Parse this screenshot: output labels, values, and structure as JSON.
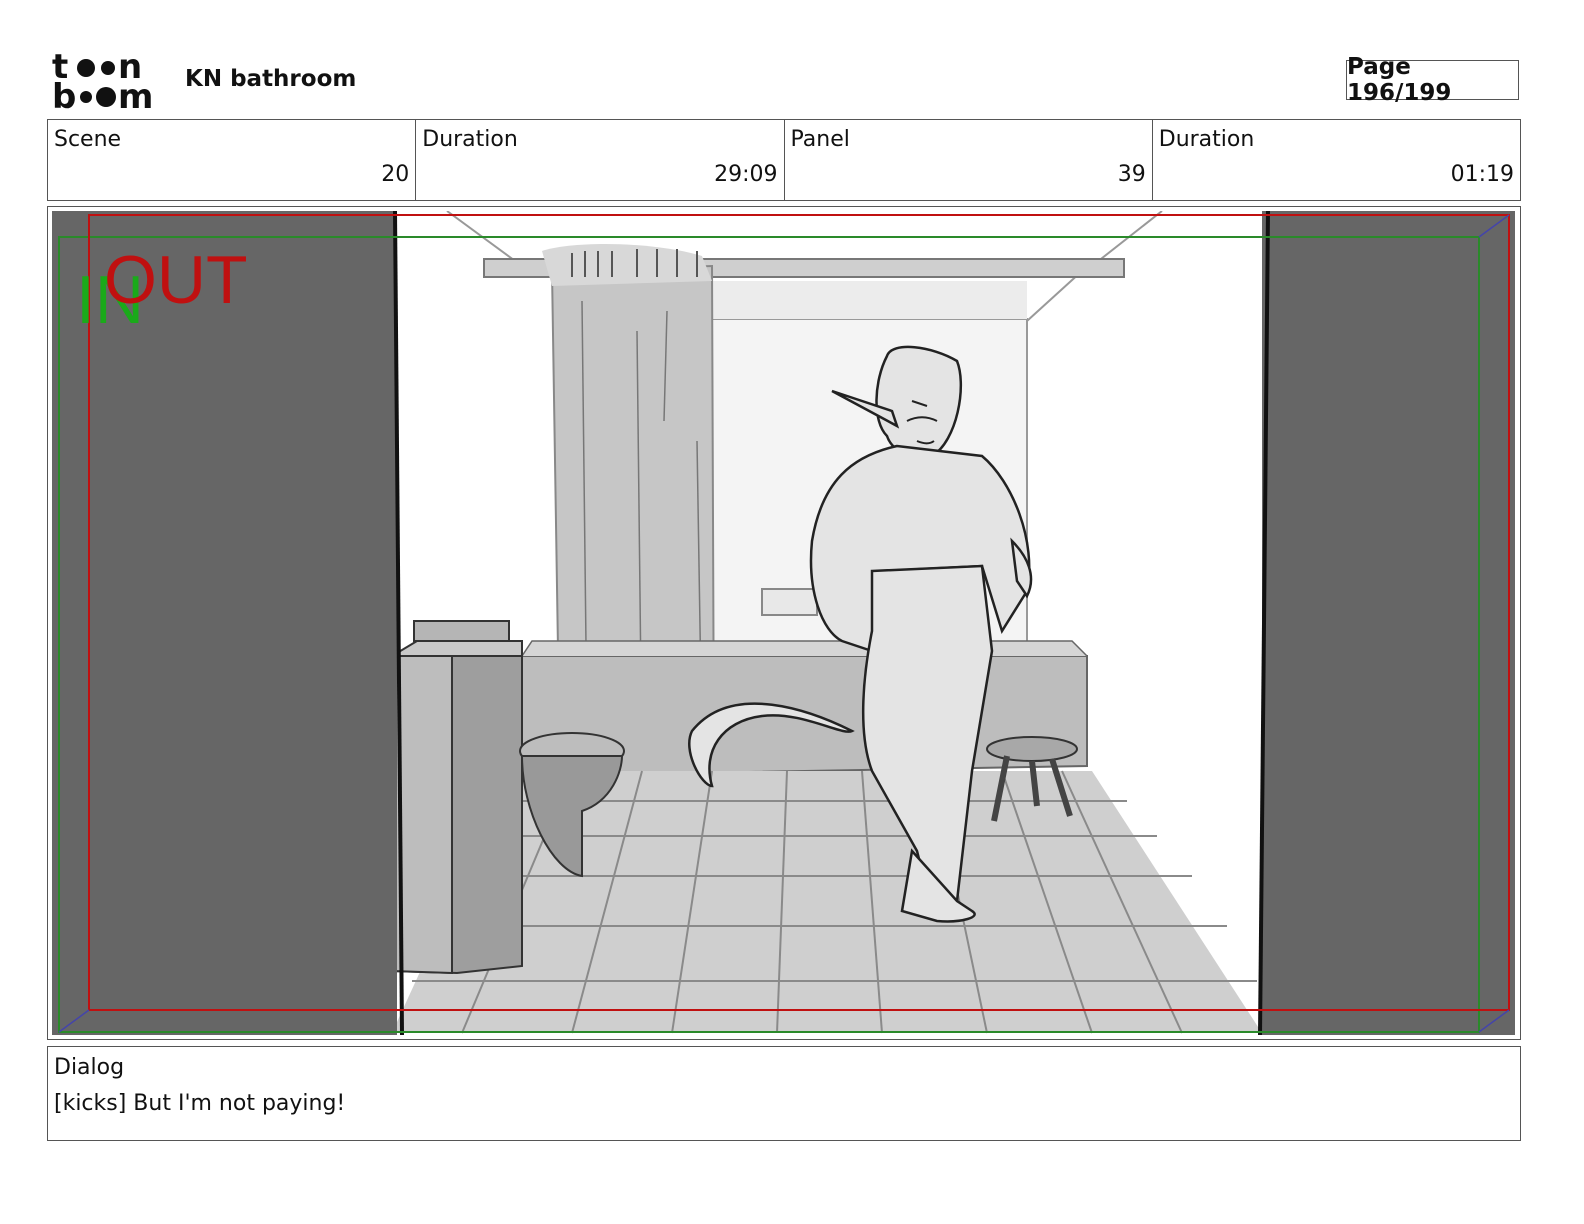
{
  "header": {
    "logo_text": "toon boom",
    "project_title": "KN bathroom",
    "page_label": "Page 196/199"
  },
  "info": {
    "scene_label": "Scene",
    "scene_value": "20",
    "scene_duration_label": "Duration",
    "scene_duration_value": "29:09",
    "panel_label": "Panel",
    "panel_value": "39",
    "panel_duration_label": "Duration",
    "panel_duration_value": "01:19"
  },
  "panel": {
    "in_marker": "IN",
    "out_marker": "OUT",
    "colors": {
      "in": "#1aaa1a",
      "out": "#c01010",
      "mask": "#666666"
    }
  },
  "dialog": {
    "label": "Dialog",
    "text": "[kicks] But I'm not paying!"
  }
}
